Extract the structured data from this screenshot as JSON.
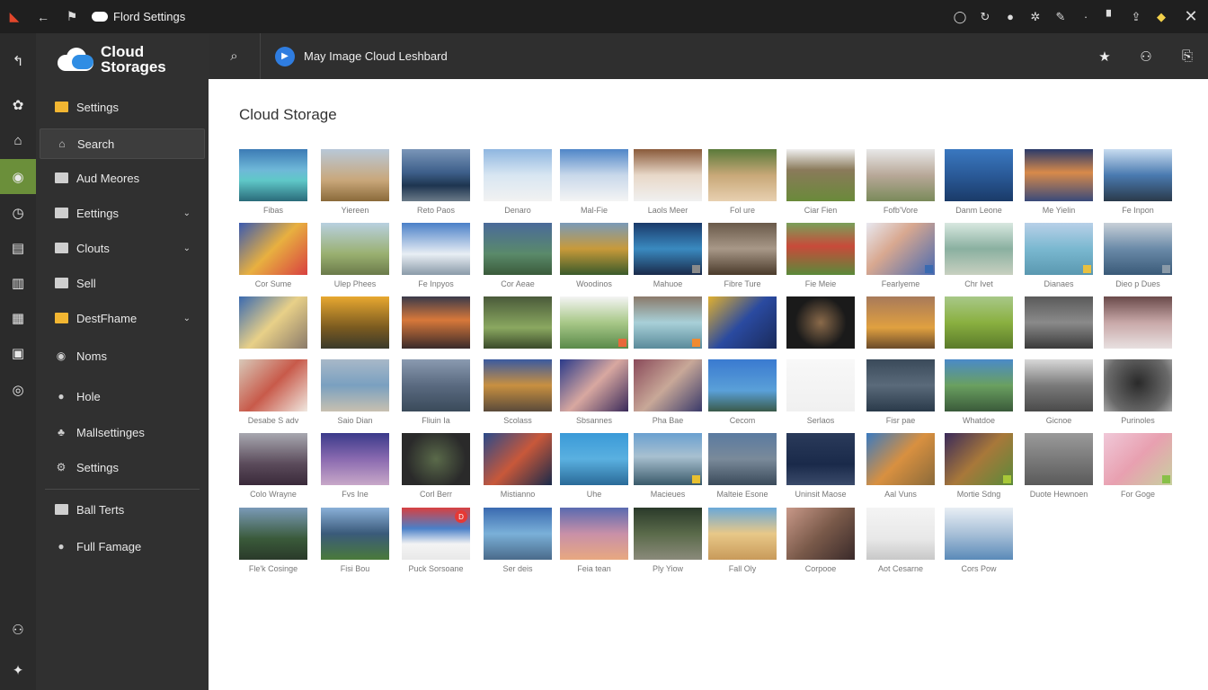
{
  "titlebar": {
    "title": "Flord Settings",
    "colors": {
      "app_icon": "#e2462b",
      "bar": "#1f1f1f"
    }
  },
  "rail": {
    "items": [
      {
        "icon": "back-arrow-icon",
        "glyph": "↰"
      },
      {
        "icon": "photo-icon",
        "glyph": "✿"
      },
      {
        "icon": "home-icon",
        "glyph": "⌂"
      },
      {
        "icon": "compass-icon",
        "glyph": "◉",
        "active": true
      },
      {
        "icon": "clock-icon",
        "glyph": "◷"
      },
      {
        "icon": "panel-icon",
        "glyph": "▤"
      },
      {
        "icon": "document-icon",
        "glyph": "▥"
      },
      {
        "icon": "layout-icon",
        "glyph": "▦"
      },
      {
        "icon": "frame-icon",
        "glyph": "▣"
      },
      {
        "icon": "refresh-icon",
        "glyph": "◎"
      },
      {
        "icon": "user-icon",
        "glyph": "⚇"
      },
      {
        "icon": "star-settings-icon",
        "glyph": "✦"
      }
    ]
  },
  "sidebar": {
    "logo_text": "Cloud Storages",
    "items": [
      {
        "label": "Settings",
        "icon": "folder-icon",
        "folder": "yellow"
      },
      {
        "label": "Search",
        "icon": "home-icon",
        "selected": true
      },
      {
        "label": "Aud Meores",
        "icon": "file-icon",
        "folder": "gray"
      },
      {
        "label": "Eettings",
        "icon": "folder-icon",
        "folder": "gray",
        "chevron": true
      },
      {
        "label": "Clouts",
        "icon": "folder-icon",
        "folder": "gray",
        "chevron": true
      },
      {
        "label": "Sell",
        "icon": "folder-icon",
        "folder": "gray"
      },
      {
        "label": "DestFhame",
        "icon": "folder-icon",
        "folder": "yellow",
        "chevron": true
      },
      {
        "label": "Noms",
        "icon": "gear-icon"
      },
      {
        "label": "Hole",
        "icon": "user-icon"
      },
      {
        "label": "Mallsettinges",
        "icon": "people-icon"
      },
      {
        "label": "Settings",
        "icon": "settings-user-icon"
      },
      {
        "label": "Ball Terts",
        "icon": "file-icon",
        "folder": "gray"
      },
      {
        "label": "Full Famage",
        "icon": "user-icon"
      }
    ]
  },
  "topbar": {
    "breadcrumb": "May Image Cloud Leshbard"
  },
  "main": {
    "title": "Cloud Storage",
    "tiles": [
      {
        "cap": "Fibas",
        "bg": "linear-gradient(180deg,#3c7bb5 0%,#6fb8d8 40%,#5fc8c8 60%,#2a6b7a 100%)"
      },
      {
        "cap": "Yiereen",
        "bg": "linear-gradient(180deg,#b8c8d8 0%,#c9a77a 60%,#8a6a3a 100%)"
      },
      {
        "cap": "Reto Paos",
        "bg": "linear-gradient(180deg,#7a95b8 0%,#3d5f8a 45%,#1e3550 70%,#6a7a88 100%)"
      },
      {
        "cap": "Denaro",
        "bg": "linear-gradient(180deg,#8fb6e0 0%,#d8e6f2 50%,#f2f2f2 100%)"
      },
      {
        "cap": "Mal-Fie",
        "bg": "linear-gradient(180deg,#4f86c8 0%,#c8d8ea 50%,#f4f4f4 100%)"
      },
      {
        "cap": "Laols Meer",
        "bg": "linear-gradient(180deg,#8a5a3a 0%,#e8d8c8 50%,#f0f0f0 100%)"
      },
      {
        "cap": "Fol ure",
        "bg": "linear-gradient(180deg,#5a7a3a 0%,#c8a878 50%,#e8d0b0 100%)"
      },
      {
        "cap": "Ciar Fien",
        "bg": "linear-gradient(180deg,#f0f0f0 0%,#8a7a5a 40%,#6a8a3a 100%)"
      },
      {
        "cap": "Fofb'Vore",
        "bg": "linear-gradient(180deg,#e8e8e8 0%,#b8a898 50%,#7a8a5a 100%)"
      },
      {
        "cap": "Danm Leone",
        "bg": "linear-gradient(180deg,#3a78c0 0%,#2a5a98 50%,#1a3a68 100%)"
      },
      {
        "cap": "Me Yielin",
        "bg": "linear-gradient(180deg,#2a3a6a 0%,#d88a4a 45%,#3a4a7a 100%)"
      },
      {
        "cap": "Fe Inpon",
        "bg": "linear-gradient(180deg,#c8dcf0 0%,#4a7ab0 50%,#2a3a4a 100%)"
      },
      {
        "cap": "Cor Sume",
        "bg": "linear-gradient(135deg,#3a5ab0 0%,#e8b040 50%,#d84040 100%)"
      },
      {
        "cap": "Ulep Phees",
        "bg": "linear-gradient(180deg,#b8d0e0 0%,#9ab070 60%,#6a7a4a 100%)"
      },
      {
        "cap": "Fe Inpyos",
        "bg": "linear-gradient(180deg,#4a80c8 0%,#e8eef4 60%,#8a9aa8 100%)"
      },
      {
        "cap": "Cor Aeae",
        "bg": "linear-gradient(180deg,#4a6a9a 0%,#5a8a6a 60%,#3a5a3a 100%)"
      },
      {
        "cap": "Woodinos",
        "bg": "linear-gradient(180deg,#7a9ab8 0%,#c89a3a 50%,#3a5a2a 100%)"
      },
      {
        "cap": "Mahuoe",
        "bg": "linear-gradient(180deg,#1a3a6a 0%,#3a8ac0 50%,#1a2a4a 100%)"
      },
      {
        "cap": "Fibre Ture",
        "bg": "linear-gradient(180deg,#6a5a4a 0%,#a89888 50%,#4a3a2a 100%)"
      },
      {
        "cap": "Fie Meie",
        "bg": "linear-gradient(180deg,#7aa05a 0%,#c84a3a 45%,#5a8a3a 100%)"
      },
      {
        "cap": "Fearlyeme",
        "bg": "linear-gradient(135deg,#e8e8f0 0%,#d8a890 40%,#4a6ab0 100%)"
      },
      {
        "cap": "Chr Ivet",
        "bg": "linear-gradient(180deg,#d8e8e0 0%,#8ab0a0 50%,#c8d0c0 100%)"
      },
      {
        "cap": "Dianaes",
        "bg": "linear-gradient(180deg,#b8d0e8 0%,#7ab8d0 50%,#5a98b0 100%)"
      },
      {
        "cap": "Dieo p Dues",
        "bg": "linear-gradient(180deg,#c8d0d8 0%,#6a8aa8 50%,#3a5a78 100%)"
      },
      {
        "cap": "",
        "bg": "linear-gradient(135deg,#3a6ab0 0%,#e8d088 50%,#8a7a6a 100%)"
      },
      {
        "cap": "",
        "bg": "linear-gradient(180deg,#e8a830 0%,#7a5a20 60%,#3a3a2a 100%)"
      },
      {
        "cap": "",
        "bg": "linear-gradient(180deg,#3a3a4a 0%,#d8783a 45%,#3a2a2a 100%)"
      },
      {
        "cap": "",
        "bg": "linear-gradient(180deg,#4a5a3a 0%,#8aa860 60%,#3a4a2a 100%)"
      },
      {
        "cap": "",
        "bg": "linear-gradient(180deg,#f4f4f4 0%,#a8c888 50%,#5a8a4a 100%)"
      },
      {
        "cap": "",
        "bg": "linear-gradient(180deg,#8a7a6a 0%,#a8d0d8 50%,#5a8a9a 100%)"
      },
      {
        "cap": "",
        "bg": "linear-gradient(135deg,#e0b030 0%,#2a4aa0 50%,#1a2a5a 100%)"
      },
      {
        "cap": "",
        "bg": "radial-gradient(circle at 50% 50%,#8a6a4a 0%,#1a1a1a 60%)"
      },
      {
        "cap": "",
        "bg": "linear-gradient(180deg,#a87a5a 0%,#e0a040 60%,#6a4a2a 100%)"
      },
      {
        "cap": "",
        "bg": "linear-gradient(180deg,#a8c888 0%,#8ab040 50%,#5a7a2a 100%)"
      },
      {
        "cap": "",
        "bg": "linear-gradient(180deg,#5a5a5a 0%,#8a8a8a 50%,#3a3a3a 100%)"
      },
      {
        "cap": "",
        "bg": "linear-gradient(180deg,#6a4a4a 0%,#c8a8a8 50%,#e8e0e0 100%)"
      },
      {
        "cap": "Desabe S adv",
        "bg": "linear-gradient(135deg,#d8c8b8 0%,#c85a4a 50%,#f0e8e0 100%)"
      },
      {
        "cap": "Saio Dian",
        "bg": "linear-gradient(180deg,#a8b8c8 0%,#7aa0c0 50%,#c8c0b0 100%)"
      },
      {
        "cap": "Fliuin Ia",
        "bg": "linear-gradient(180deg,#8a9ab0 0%,#5a6a80 50%,#3a4a5a 100%)"
      },
      {
        "cap": "Scolass",
        "bg": "linear-gradient(180deg,#3a5aa0 0%,#c89040 50%,#5a4a3a 100%)"
      },
      {
        "cap": "Sbsannes",
        "bg": "linear-gradient(135deg,#2a3a8a 0%,#d8a8a0 50%,#3a2a5a 100%)"
      },
      {
        "cap": "Pha Bae",
        "bg": "linear-gradient(135deg,#8a4a5a 0%,#c8a898 50%,#3a3a6a 100%)"
      },
      {
        "cap": "Cecom",
        "bg": "linear-gradient(180deg,#3a7ad0 0%,#5aa0d8 60%,#3a5a4a 100%)"
      },
      {
        "cap": "Serlaos",
        "bg": "linear-gradient(180deg,#f8f8f8 0%,#f0f0f0 100%)"
      },
      {
        "cap": "Fisr pae",
        "bg": "linear-gradient(180deg,#3a4a5a 0%,#5a6a7a 50%,#2a3a4a 100%)"
      },
      {
        "cap": "Whatdoe",
        "bg": "linear-gradient(180deg,#4a8ac8 0%,#6aa060 50%,#3a5a3a 100%)"
      },
      {
        "cap": "Gicnoe",
        "bg": "linear-gradient(180deg,#d8d8d8 0%,#7a7a7a 50%,#4a4a4a 100%)"
      },
      {
        "cap": "Purinoles",
        "bg": "radial-gradient(circle at 50% 45%,#2a2a2a 0%,#6a6a6a 70%,#a8a8a8 100%)"
      },
      {
        "cap": "Colo Wrayne",
        "bg": "linear-gradient(180deg,#a8a8b0 0%,#5a4a5a 60%,#3a2a3a 100%)"
      },
      {
        "cap": "Fvs Ine",
        "bg": "linear-gradient(180deg,#3a3a8a 0%,#8a6ab0 50%,#c8a8c8 100%)"
      },
      {
        "cap": "Corl Berr",
        "bg": "radial-gradient(circle at 50% 50%,#5a6a4a 0%,#2a2a2a 70%)"
      },
      {
        "cap": "Mistianno",
        "bg": "linear-gradient(135deg,#2a4a8a 0%,#c8583a 50%,#1a2a4a 100%)"
      },
      {
        "cap": "Uhe",
        "bg": "linear-gradient(180deg,#3a9ad8 0%,#5ab0e0 50%,#2a6a98 100%)"
      },
      {
        "cap": "Macieues",
        "bg": "linear-gradient(180deg,#6aa0d0 0%,#a8c0d0 45%,#3a5a6a 100%)"
      },
      {
        "cap": "Malteie Esone",
        "bg": "linear-gradient(180deg,#5a7aa0 0%,#7a8a9a 50%,#3a4a5a 100%)"
      },
      {
        "cap": "Uninsit Maose",
        "bg": "linear-gradient(180deg,#2a3a5a 0%,#1a2a4a 60%,#3a4a6a 100%)"
      },
      {
        "cap": "Aal Vuns",
        "bg": "linear-gradient(135deg,#3a7ac0 0%,#d89040 50%,#8a6a3a 100%)"
      },
      {
        "cap": "Mortie Sdng",
        "bg": "linear-gradient(135deg,#3a2a5a 0%,#a8783a 50%,#5a8a3a 100%)"
      },
      {
        "cap": "Duote Hewnoen",
        "bg": "linear-gradient(180deg,#9a9a9a 0%,#7a7a7a 50%,#5a5a5a 100%)"
      },
      {
        "cap": "For Goge",
        "bg": "linear-gradient(135deg,#f0c8d8 0%,#e8a0b0 50%,#c8d0a0 100%)"
      },
      {
        "cap": "Fle'k Cosinge",
        "bg": "linear-gradient(180deg,#7a9ab8 0%,#3a5a3a 60%,#2a3a2a 100%)"
      },
      {
        "cap": "Fisi Bou",
        "bg": "linear-gradient(180deg,#8ab0d8 0%,#3a5a7a 50%,#4a7a3a 100%)"
      },
      {
        "cap": "Puck Sorsoane",
        "bg": "linear-gradient(180deg,#d84040 0%,#4a80c8 40%,#f4f4f4 70%,#e8e8e8 100%)"
      },
      {
        "cap": "Ser deis",
        "bg": "linear-gradient(180deg,#3a6ab0 0%,#7ab0d8 50%,#4a6a8a 100%)"
      },
      {
        "cap": "Feia tean",
        "bg": "linear-gradient(180deg,#5a6ab0 0%,#c890a8 50%,#e8a880 100%)"
      },
      {
        "cap": "Ply Yiow",
        "bg": "linear-gradient(180deg,#2a3a2a 0%,#5a6a4a 50%,#8a8a7a 100%)"
      },
      {
        "cap": "Fall Oly",
        "bg": "linear-gradient(180deg,#6aa8d8 0%,#e8c888 50%,#c89a5a 100%)"
      },
      {
        "cap": "Corpooe",
        "bg": "linear-gradient(135deg,#c89888 0%,#7a5a4a 50%,#3a2a2a 100%)"
      },
      {
        "cap": "Aot Cesarne",
        "bg": "linear-gradient(180deg,#f4f4f4 0%,#e8e8e8 60%,#c8c8c8 100%)"
      },
      {
        "cap": "Cors Pow",
        "bg": "linear-gradient(180deg,#e8eef4 0%,#a8c0d8 50%,#5a8ab8 100%)"
      }
    ],
    "badges": {
      "28": {
        "type": "square",
        "color": "#e8683a"
      },
      "29": {
        "type": "square",
        "color": "#f08a30"
      },
      "17": {
        "type": "square",
        "color": "#8a8a8a"
      },
      "20": {
        "type": "square",
        "color": "#3a6ab0"
      },
      "22": {
        "type": "square",
        "color": "#e8c040"
      },
      "23": {
        "type": "square",
        "color": "#8a9aa8"
      },
      "53": {
        "type": "square",
        "color": "#e8c030"
      },
      "57": {
        "type": "square",
        "color": "#a8c838"
      },
      "59": {
        "type": "square",
        "color": "#88c048"
      },
      "62": {
        "type": "red",
        "text": "D"
      }
    }
  }
}
